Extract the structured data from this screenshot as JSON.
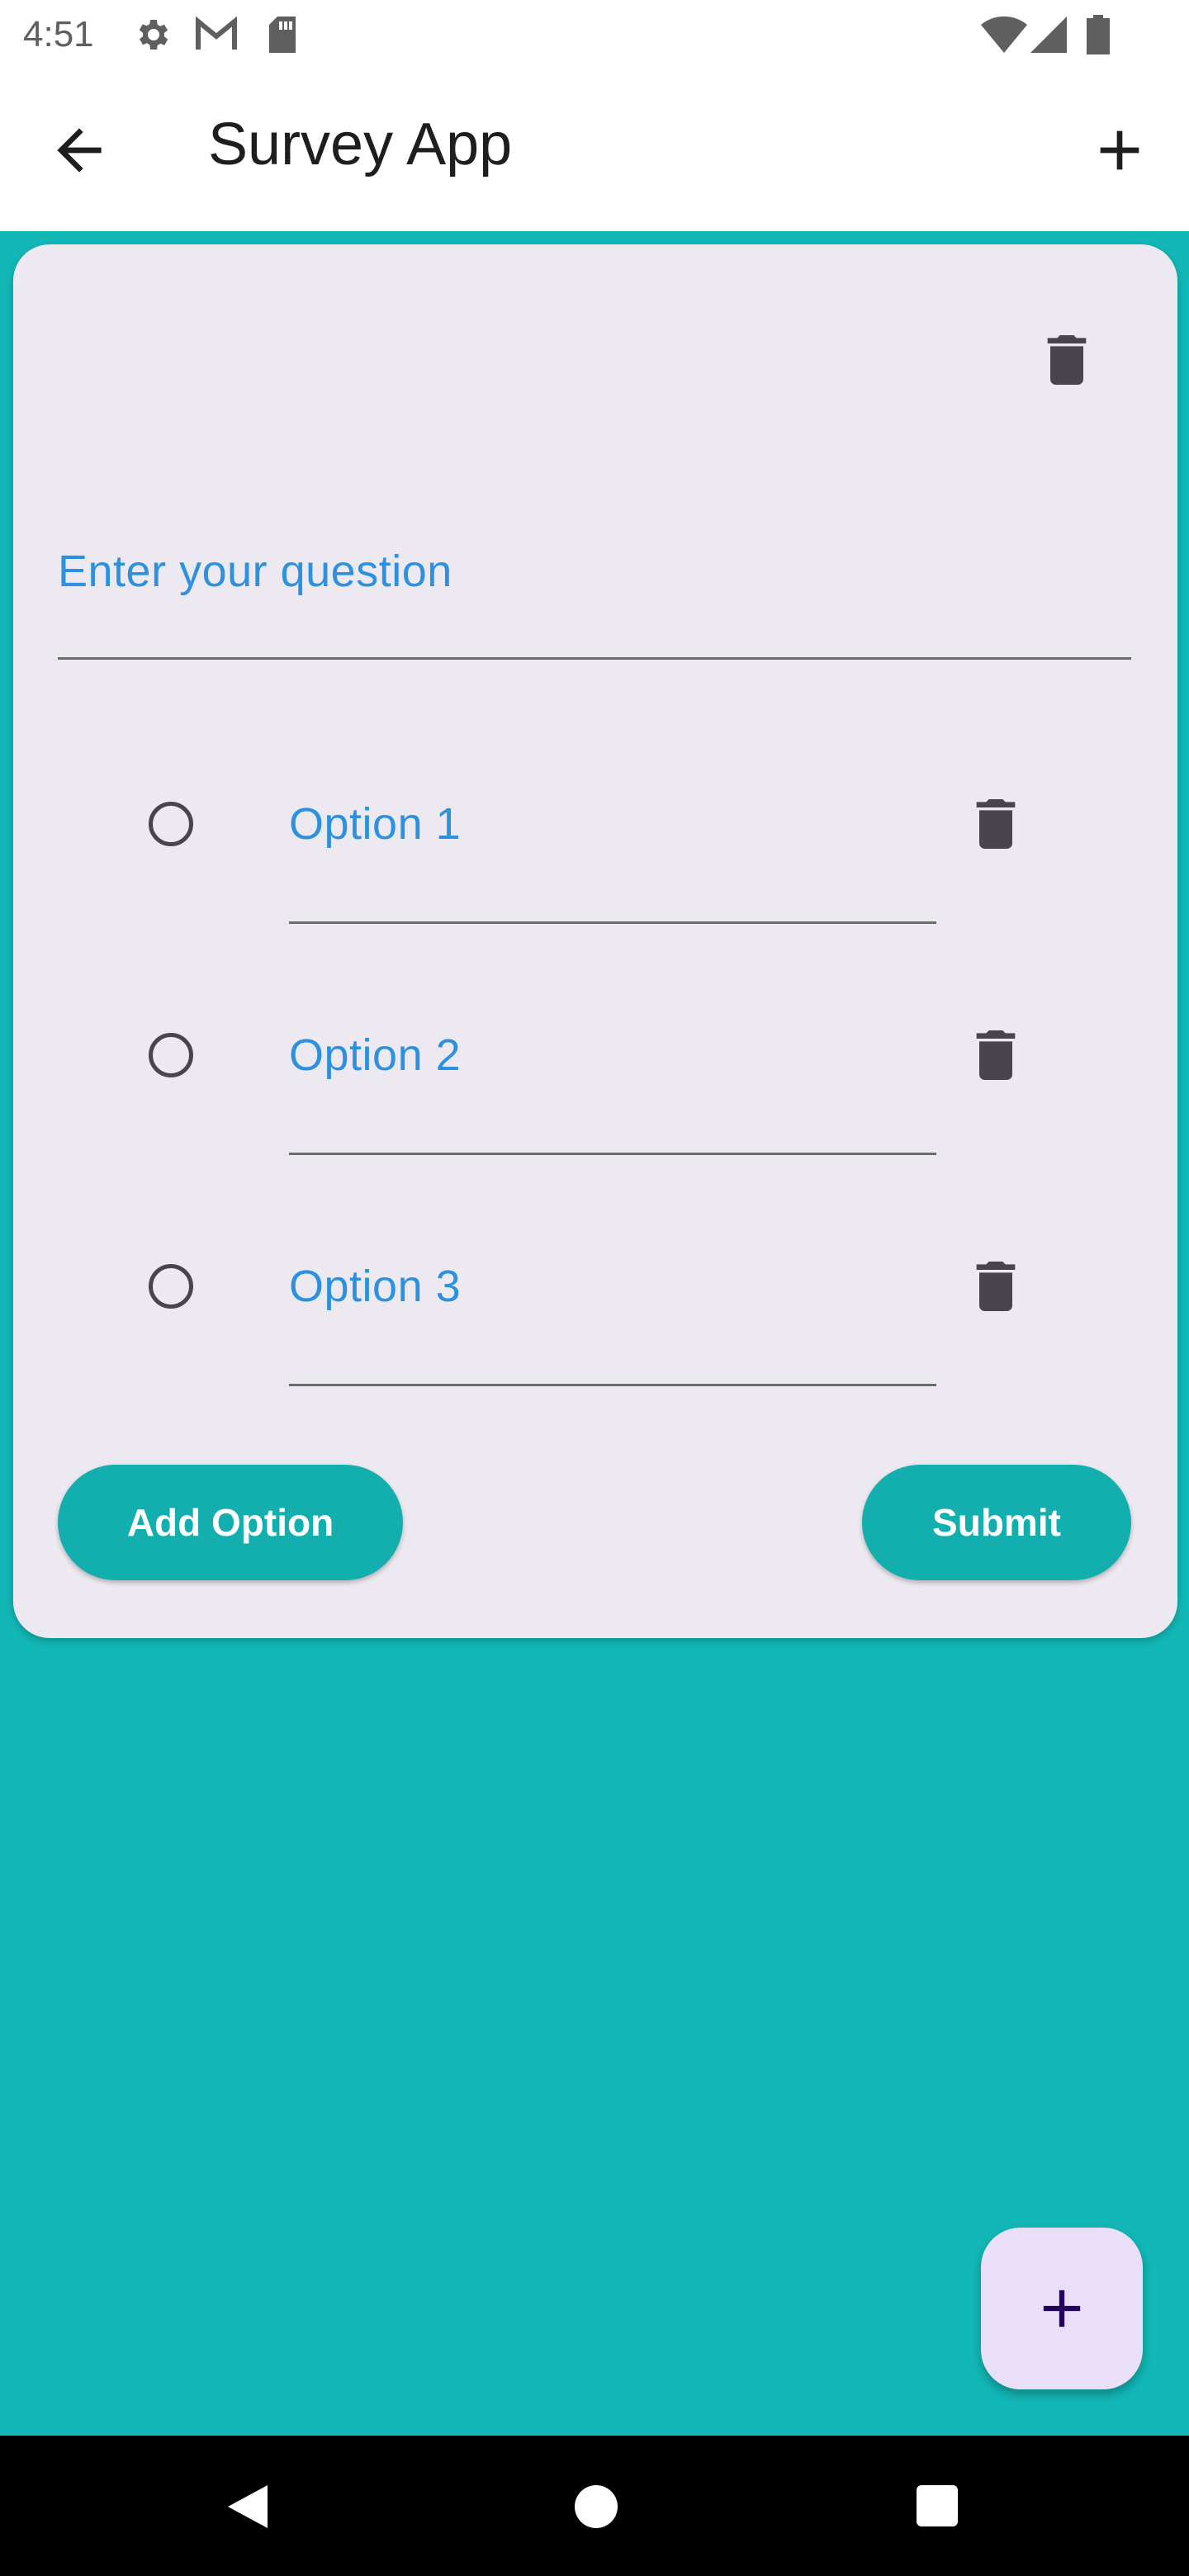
{
  "status_bar": {
    "time": "4:51",
    "left_icons": [
      "settings-icon",
      "gmail-icon",
      "sd-card-icon"
    ],
    "right_icons": [
      "wifi-icon",
      "signal-icon",
      "battery-icon"
    ]
  },
  "app_bar": {
    "title": "Survey App",
    "back_icon": "arrow-back-icon",
    "action_icon": "plus-icon"
  },
  "question_card": {
    "question_placeholder": "Enter your question",
    "options": [
      {
        "label": "Option 1"
      },
      {
        "label": "Option 2"
      },
      {
        "label": "Option 3"
      }
    ],
    "add_option_label": "Add Option",
    "submit_label": "Submit"
  },
  "fab": {
    "icon": "plus-icon"
  },
  "nav_bar": {
    "icons": [
      "back-triangle-icon",
      "home-circle-icon",
      "recents-square-icon"
    ]
  },
  "colors": {
    "background": "#12b8b7",
    "accent_button": "#12afae",
    "field_text": "#2d91e0",
    "card": "#ede9f1",
    "fab": "#eadff8"
  }
}
